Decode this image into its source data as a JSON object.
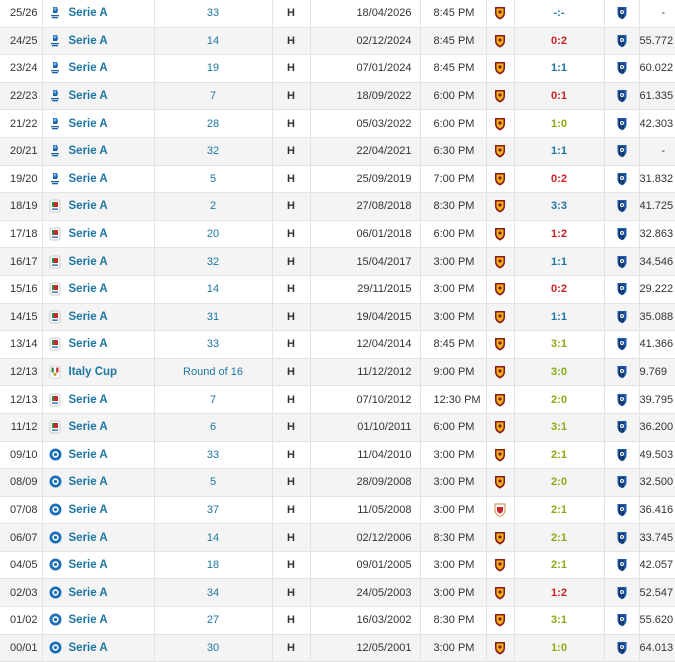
{
  "colors": {
    "win": "#8aaa14",
    "draw": "#1d75a3",
    "loss": "#cc1f1f",
    "link": "#1d75a3"
  },
  "matches": [
    {
      "season": "25/26",
      "comp": "Serie A",
      "logo": "serie-a-new",
      "round": "33",
      "venue": "H",
      "date": "18/04/2026",
      "time": "8:45 PM",
      "home_crest": "roma",
      "result": "-:-",
      "outcome": "none",
      "away_crest": "atalanta",
      "att": "-"
    },
    {
      "season": "24/25",
      "comp": "Serie A",
      "logo": "serie-a-new",
      "round": "14",
      "venue": "H",
      "date": "02/12/2024",
      "time": "8:45 PM",
      "home_crest": "roma",
      "result": "0:2",
      "outcome": "loss",
      "away_crest": "atalanta",
      "att": "55.772"
    },
    {
      "season": "23/24",
      "comp": "Serie A",
      "logo": "serie-a-new",
      "round": "19",
      "venue": "H",
      "date": "07/01/2024",
      "time": "8:45 PM",
      "home_crest": "roma",
      "result": "1:1",
      "outcome": "draw",
      "away_crest": "atalanta",
      "att": "60.022"
    },
    {
      "season": "22/23",
      "comp": "Serie A",
      "logo": "serie-a-new",
      "round": "7",
      "venue": "H",
      "date": "18/09/2022",
      "time": "6:00 PM",
      "home_crest": "roma",
      "result": "0:1",
      "outcome": "loss",
      "away_crest": "atalanta",
      "att": "61.335"
    },
    {
      "season": "21/22",
      "comp": "Serie A",
      "logo": "serie-a-new",
      "round": "28",
      "venue": "H",
      "date": "05/03/2022",
      "time": "6:00 PM",
      "home_crest": "roma",
      "result": "1:0",
      "outcome": "win",
      "away_crest": "atalanta",
      "att": "42.303"
    },
    {
      "season": "20/21",
      "comp": "Serie A",
      "logo": "serie-a-new",
      "round": "32",
      "venue": "H",
      "date": "22/04/2021",
      "time": "6:30 PM",
      "home_crest": "roma",
      "result": "1:1",
      "outcome": "draw",
      "away_crest": "atalanta",
      "att": "-"
    },
    {
      "season": "19/20",
      "comp": "Serie A",
      "logo": "serie-a-new",
      "round": "5",
      "venue": "H",
      "date": "25/09/2019",
      "time": "7:00 PM",
      "home_crest": "roma",
      "result": "0:2",
      "outcome": "loss",
      "away_crest": "atalanta",
      "att": "31.832"
    },
    {
      "season": "18/19",
      "comp": "Serie A",
      "logo": "serie-a-tim",
      "round": "2",
      "venue": "H",
      "date": "27/08/2018",
      "time": "8:30 PM",
      "home_crest": "roma",
      "result": "3:3",
      "outcome": "draw",
      "away_crest": "atalanta",
      "att": "41.725"
    },
    {
      "season": "17/18",
      "comp": "Serie A",
      "logo": "serie-a-tim",
      "round": "20",
      "venue": "H",
      "date": "06/01/2018",
      "time": "6:00 PM",
      "home_crest": "roma",
      "result": "1:2",
      "outcome": "loss",
      "away_crest": "atalanta",
      "att": "32.863"
    },
    {
      "season": "16/17",
      "comp": "Serie A",
      "logo": "serie-a-tim",
      "round": "32",
      "venue": "H",
      "date": "15/04/2017",
      "time": "3:00 PM",
      "home_crest": "roma",
      "result": "1:1",
      "outcome": "draw",
      "away_crest": "atalanta",
      "att": "34.546"
    },
    {
      "season": "15/16",
      "comp": "Serie A",
      "logo": "serie-a-tim",
      "round": "14",
      "venue": "H",
      "date": "29/11/2015",
      "time": "3:00 PM",
      "home_crest": "roma",
      "result": "0:2",
      "outcome": "loss",
      "away_crest": "atalanta",
      "att": "29.222"
    },
    {
      "season": "14/15",
      "comp": "Serie A",
      "logo": "serie-a-tim",
      "round": "31",
      "venue": "H",
      "date": "19/04/2015",
      "time": "3:00 PM",
      "home_crest": "roma",
      "result": "1:1",
      "outcome": "draw",
      "away_crest": "atalanta",
      "att": "35.088"
    },
    {
      "season": "13/14",
      "comp": "Serie A",
      "logo": "serie-a-tim",
      "round": "33",
      "venue": "H",
      "date": "12/04/2014",
      "time": "8:45 PM",
      "home_crest": "roma",
      "result": "3:1",
      "outcome": "win",
      "away_crest": "atalanta",
      "att": "41.366"
    },
    {
      "season": "12/13",
      "comp": "Italy Cup",
      "logo": "coppa-italia",
      "round": "Round of 16",
      "venue": "H",
      "date": "11/12/2012",
      "time": "9:00 PM",
      "home_crest": "roma",
      "result": "3:0",
      "outcome": "win",
      "away_crest": "atalanta",
      "att": "9.769"
    },
    {
      "season": "12/13",
      "comp": "Serie A",
      "logo": "serie-a-tim",
      "round": "7",
      "venue": "H",
      "date": "07/10/2012",
      "time": "12:30 PM",
      "home_crest": "roma",
      "result": "2:0",
      "outcome": "win",
      "away_crest": "atalanta",
      "att": "39.795"
    },
    {
      "season": "11/12",
      "comp": "Serie A",
      "logo": "serie-a-tim",
      "round": "6",
      "venue": "H",
      "date": "01/10/2011",
      "time": "6:00 PM",
      "home_crest": "roma",
      "result": "3:1",
      "outcome": "win",
      "away_crest": "atalanta",
      "att": "36.200"
    },
    {
      "season": "09/10",
      "comp": "Serie A",
      "logo": "serie-a-old",
      "round": "33",
      "venue": "H",
      "date": "11/04/2010",
      "time": "3:00 PM",
      "home_crest": "roma",
      "result": "2:1",
      "outcome": "win",
      "away_crest": "atalanta",
      "att": "49.503"
    },
    {
      "season": "08/09",
      "comp": "Serie A",
      "logo": "serie-a-old",
      "round": "5",
      "venue": "H",
      "date": "28/09/2008",
      "time": "3:00 PM",
      "home_crest": "roma",
      "result": "2:0",
      "outcome": "win",
      "away_crest": "atalanta",
      "att": "32.500"
    },
    {
      "season": "07/08",
      "comp": "Serie A",
      "logo": "serie-a-old",
      "round": "37",
      "venue": "H",
      "date": "11/05/2008",
      "time": "3:00 PM",
      "home_crest": "roma-alt",
      "result": "2:1",
      "outcome": "win",
      "away_crest": "atalanta",
      "att": "36.416"
    },
    {
      "season": "06/07",
      "comp": "Serie A",
      "logo": "serie-a-old",
      "round": "14",
      "venue": "H",
      "date": "02/12/2006",
      "time": "8:30 PM",
      "home_crest": "roma",
      "result": "2:1",
      "outcome": "win",
      "away_crest": "atalanta",
      "att": "33.745"
    },
    {
      "season": "04/05",
      "comp": "Serie A",
      "logo": "serie-a-old",
      "round": "18",
      "venue": "H",
      "date": "09/01/2005",
      "time": "3:00 PM",
      "home_crest": "roma",
      "result": "2:1",
      "outcome": "win",
      "away_crest": "atalanta",
      "att": "42.057"
    },
    {
      "season": "02/03",
      "comp": "Serie A",
      "logo": "serie-a-old",
      "round": "34",
      "venue": "H",
      "date": "24/05/2003",
      "time": "3:00 PM",
      "home_crest": "roma",
      "result": "1:2",
      "outcome": "loss",
      "away_crest": "atalanta",
      "att": "52.547"
    },
    {
      "season": "01/02",
      "comp": "Serie A",
      "logo": "serie-a-old",
      "round": "27",
      "venue": "H",
      "date": "16/03/2002",
      "time": "8:30 PM",
      "home_crest": "roma",
      "result": "3:1",
      "outcome": "win",
      "away_crest": "atalanta",
      "att": "55.620"
    },
    {
      "season": "00/01",
      "comp": "Serie A",
      "logo": "serie-a-old",
      "round": "30",
      "venue": "H",
      "date": "12/05/2001",
      "time": "3:00 PM",
      "home_crest": "roma",
      "result": "1:0",
      "outcome": "win",
      "away_crest": "atalanta",
      "att": "64.013"
    }
  ]
}
